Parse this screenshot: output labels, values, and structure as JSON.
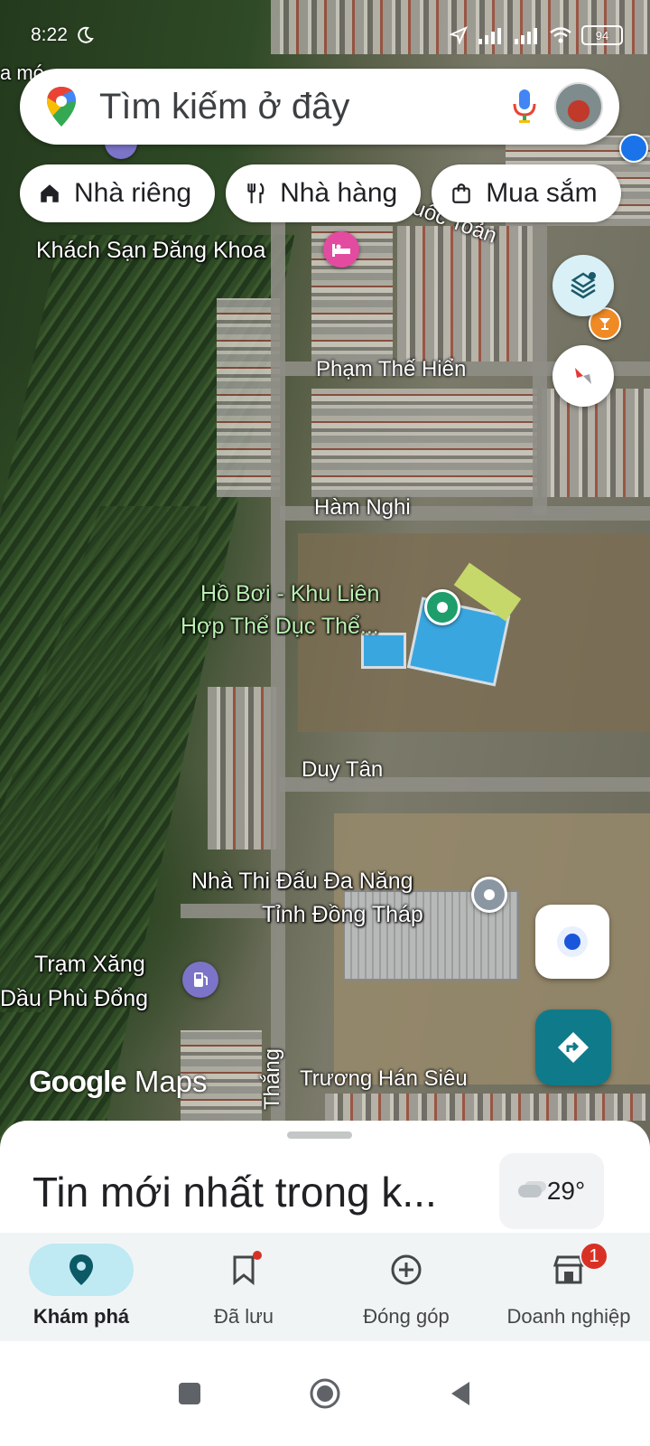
{
  "status_bar": {
    "time": "8:22",
    "battery": "94"
  },
  "search": {
    "placeholder": "Tìm kiếm ở đây"
  },
  "chips": [
    {
      "label": "Nhà riêng",
      "icon": "home-icon"
    },
    {
      "label": "Nhà hàng",
      "icon": "restaurant-icon"
    },
    {
      "label": "Mua sắm",
      "icon": "shopping-bag-icon"
    }
  ],
  "map": {
    "places": {
      "hotel": "Khách Sạn Đăng Khoa",
      "pool_line1": "Hồ Bơi - Khu Liên",
      "pool_line2": "Hợp Thể Dục Thể...",
      "arena_line1": "Nhà Thi Đấu Đa Năng",
      "arena_line2": "Tỉnh Đồng Tháp",
      "gas_line1": "Trạm Xăng",
      "gas_line2": "Dầu Phù Đổng"
    },
    "roads": {
      "pham_the_hien": "Phạm Thế Hiển",
      "ham_nghi": "Hàm Nghi",
      "duy_tan": "Duy Tân",
      "truong_han_sieu": "Trương Hán Siêu",
      "quoc_toan": "uốc Toản",
      "thang": "Thắng",
      "top_fragment": "a mó"
    },
    "watermark": {
      "brand": "Google",
      "product": "Maps"
    }
  },
  "sheet": {
    "title": "Tin mới nhất trong k...",
    "temperature": "29°"
  },
  "bottom_nav": [
    {
      "label": "Khám phá",
      "icon": "explore-pin-icon",
      "active": true
    },
    {
      "label": "Đã lưu",
      "icon": "bookmark-icon",
      "active": false
    },
    {
      "label": "Đóng góp",
      "icon": "add-circle-icon",
      "active": false
    },
    {
      "label": "Doanh nghiệp",
      "icon": "business-icon",
      "active": false,
      "badge": "1"
    }
  ],
  "colors": {
    "accent": "#0f7a8a",
    "active_nav_bg": "#bfe9f3",
    "badge": "#d93025",
    "hotel_pin": "#e34ba1",
    "park_pin": "#1e9e6a"
  }
}
